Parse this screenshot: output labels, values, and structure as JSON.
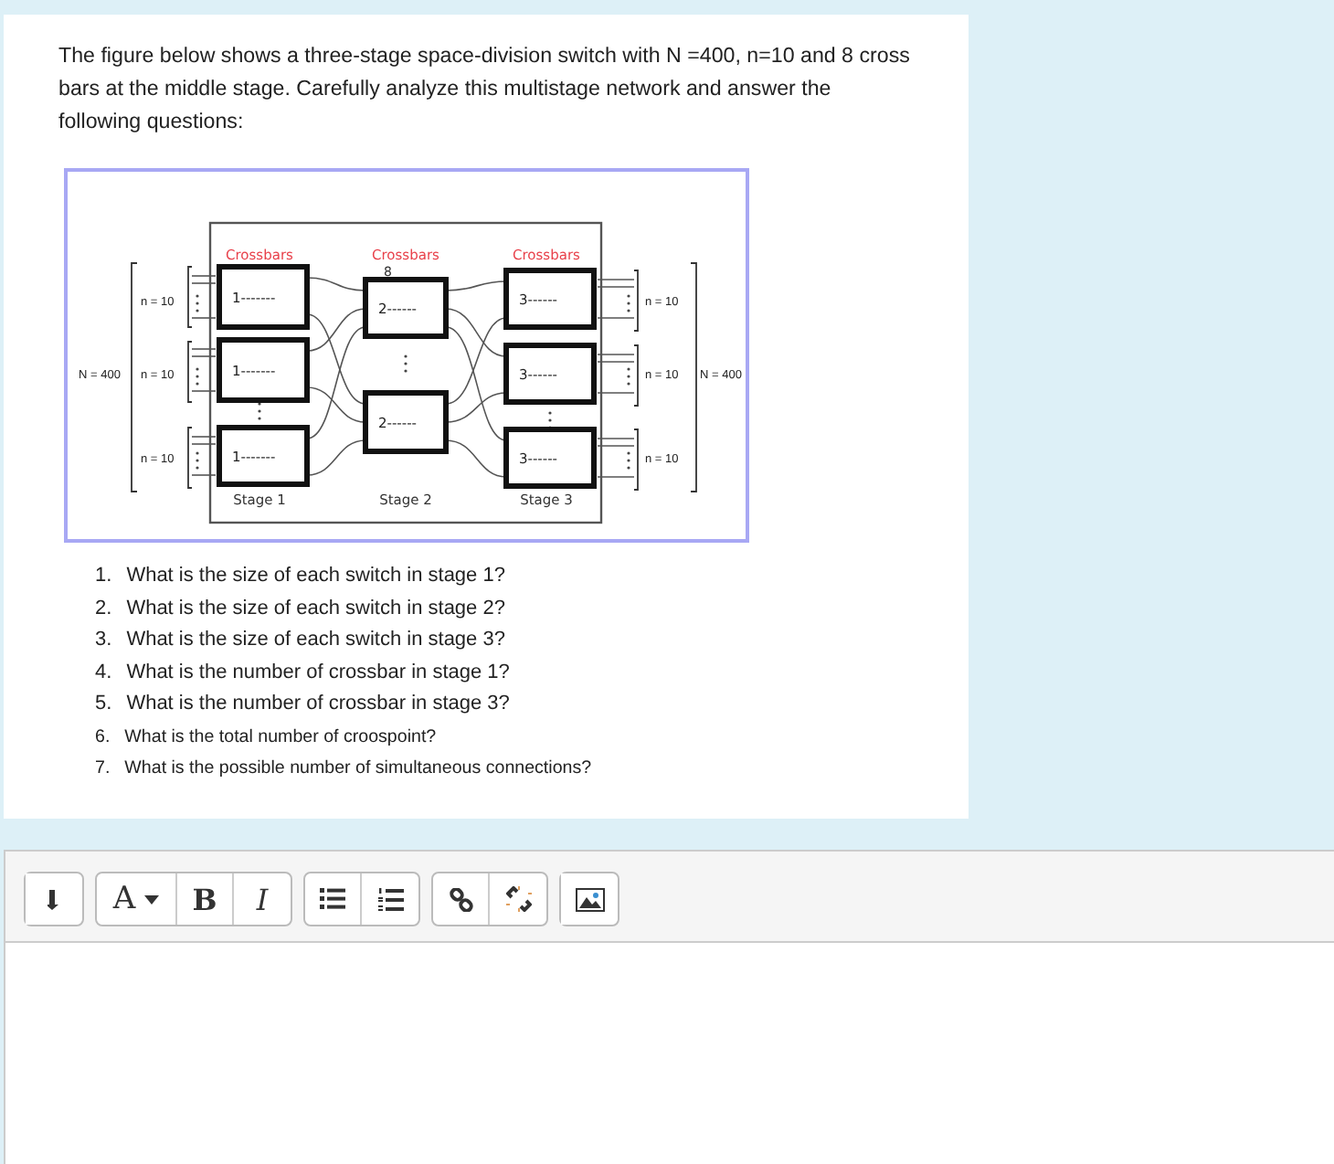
{
  "question": {
    "intro": "The figure below shows a three-stage space-division switch with N =400, n=10 and 8 cross bars at the middle stage. Carefully analyze this multistage network and answer the following questions:",
    "figure": {
      "crossbar_titles": [
        "Crossbars",
        "Crossbars",
        "Crossbars"
      ],
      "middle_count": "8",
      "stages": [
        {
          "label": "Stage 1",
          "switches": [
            "1-------",
            "1-------",
            "1-------"
          ]
        },
        {
          "label": "Stage 2",
          "switches": [
            "2------",
            "2------"
          ]
        },
        {
          "label": "Stage 3",
          "switches": [
            "3------",
            "3------",
            "3------"
          ]
        }
      ],
      "left_groups": [
        "n = 10",
        "n = 10",
        "n = 10"
      ],
      "left_total": "N = 400",
      "right_groups": [
        "n = 10",
        "n = 10",
        "n = 10"
      ],
      "right_total": "N = 400"
    },
    "items": [
      {
        "number": "1.",
        "text": "What is the size of each switch in stage 1?",
        "kind": "normal"
      },
      {
        "number": "2.",
        "text": "What is the size of each switch in stage 2?",
        "kind": "normal"
      },
      {
        "number": "3.",
        "text": "What is the size of each switch in stage 3?",
        "kind": "normal"
      },
      {
        "number": "4.",
        "text": "What is the number of crossbar in stage 1?",
        "kind": "normal"
      },
      {
        "number": "5.",
        "text": "What is the number of crossbar in stage 3?",
        "kind": "normal"
      },
      {
        "number": "6.",
        "text": "What is the total number of croospoint?",
        "kind": "small"
      },
      {
        "number": "7.",
        "text": "What is the possible number of simultaneous connections?",
        "kind": "small"
      }
    ]
  },
  "editor": {
    "toolbar": [
      [
        {
          "kind": "collapse"
        }
      ],
      [
        {
          "kind": "font-color",
          "label": "A"
        },
        {
          "kind": "bold",
          "label": "B"
        },
        {
          "kind": "italic",
          "label": "I"
        }
      ],
      [
        {
          "kind": "bullets"
        },
        {
          "kind": "numbers"
        }
      ],
      [
        {
          "kind": "link"
        },
        {
          "kind": "unlink"
        }
      ],
      [
        {
          "kind": "image"
        }
      ]
    ]
  }
}
